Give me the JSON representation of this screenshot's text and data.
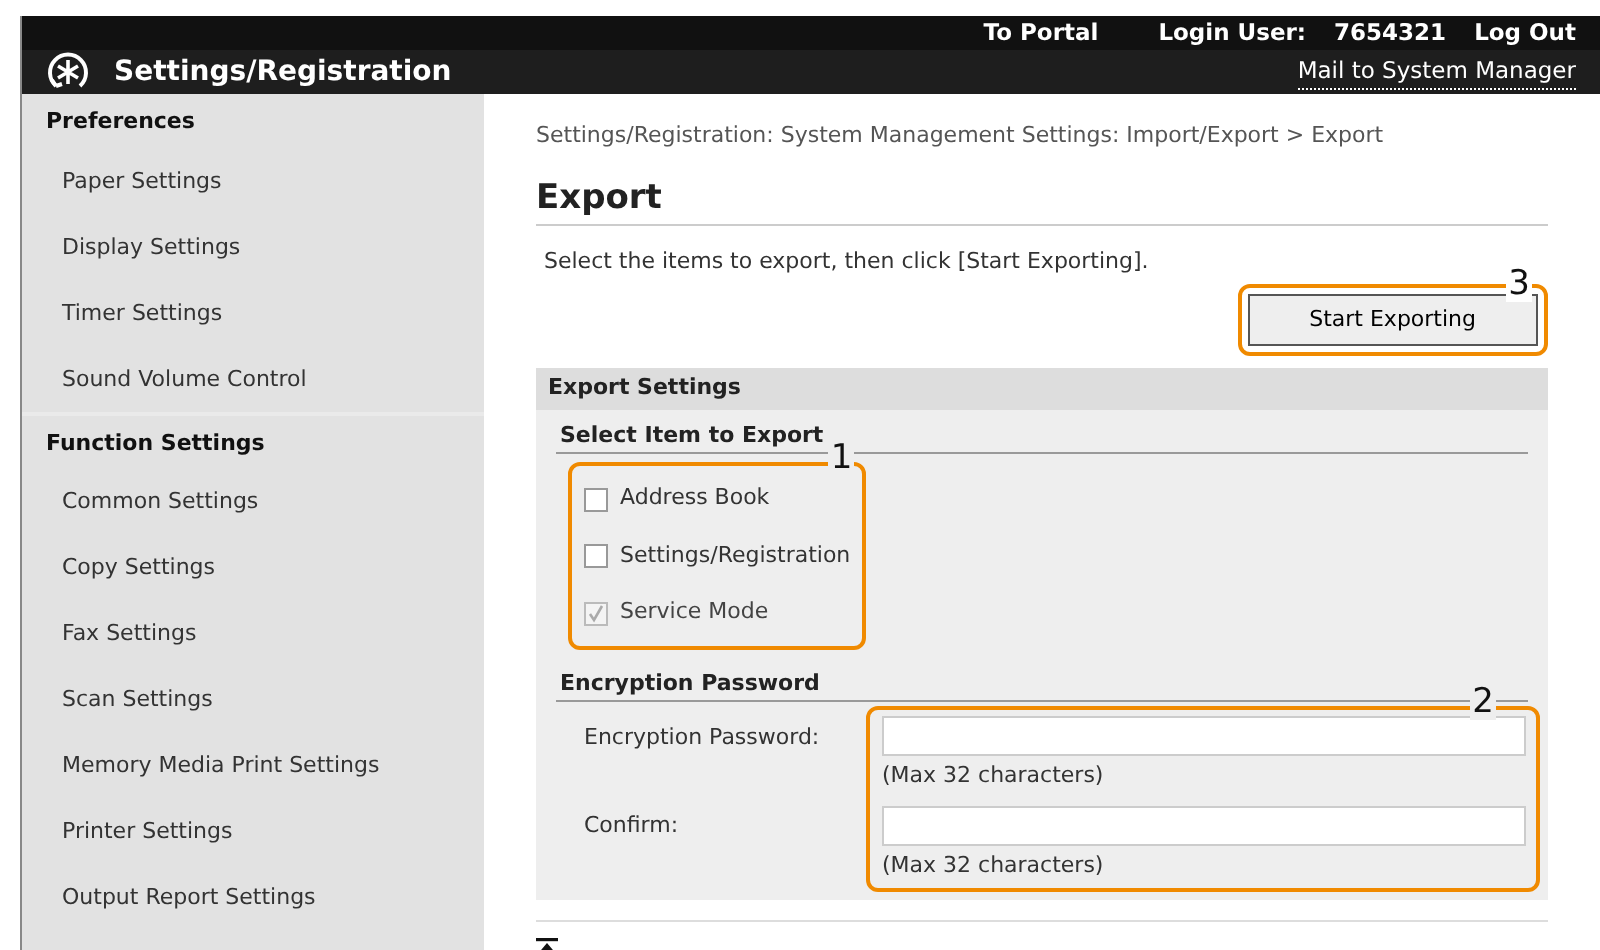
{
  "top_bar": {
    "portal_link": "To Portal",
    "login_label": "Login User:",
    "login_user": "7654321",
    "logout_link": "Log Out"
  },
  "header": {
    "title": "Settings/Registration",
    "mail_link": "Mail to System Manager"
  },
  "sidebar": {
    "sections": [
      {
        "title": "Preferences",
        "items": [
          "Paper Settings",
          "Display Settings",
          "Timer Settings",
          "Sound Volume Control"
        ]
      },
      {
        "title": "Function Settings",
        "items": [
          "Common Settings",
          "Copy Settings",
          "Fax Settings",
          "Scan Settings",
          "Memory Media Print Settings",
          "Printer Settings",
          "Output Report Settings"
        ]
      }
    ]
  },
  "breadcrumb": "Settings/Registration: System Management Settings: Import/Export > Export",
  "page_title": "Export",
  "instruction": "Select the items to export, then click [Start Exporting].",
  "start_button": {
    "label": "Start Exporting",
    "callout": "3"
  },
  "export_settings": {
    "title": "Export Settings",
    "select_heading": "Select Item to Export",
    "items_callout": "1",
    "items": [
      {
        "label": "Address Book",
        "checked": false,
        "disabled": false
      },
      {
        "label": "Settings/Registration",
        "checked": false,
        "disabled": false
      },
      {
        "label": "Service Mode",
        "checked": true,
        "disabled": true
      }
    ],
    "password_heading": "Encryption Password",
    "fields_callout": "2",
    "fields": [
      {
        "label": "Encryption Password:",
        "hint": "(Max 32 characters)"
      },
      {
        "label": "Confirm:",
        "hint": "(Max 32 characters)"
      }
    ]
  }
}
